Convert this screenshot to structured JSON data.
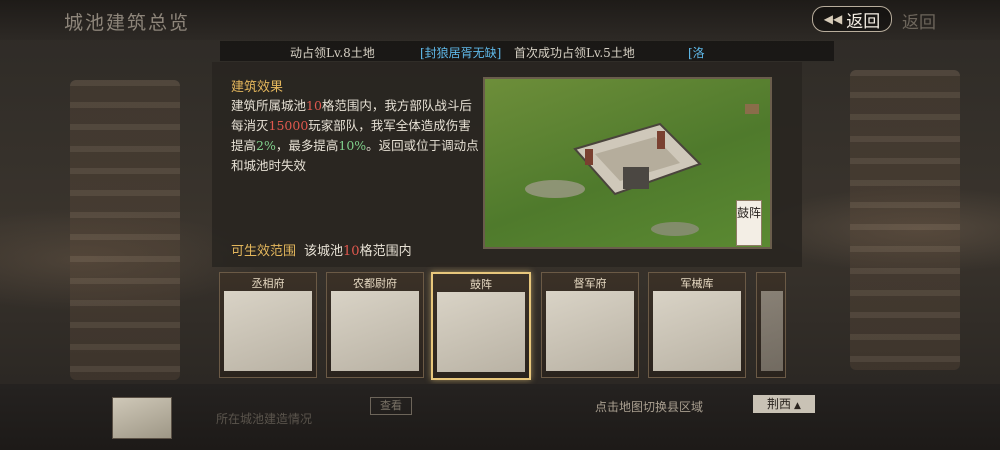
{
  "header": {
    "title": "城池建筑总览",
    "back_label": "返回",
    "back_ghost": "返回"
  },
  "ticker": {
    "part1": "动占领Lv.8土地",
    "tag": "[封狼居胥无缺]",
    "part2": "首次成功占领Lv.5土地",
    "part3": "[洛"
  },
  "effect": {
    "title": "建筑效果",
    "line_a": "建筑所属城池",
    "num_range": "10",
    "line_b": "格范围内，我方部队战斗后每消灭",
    "num_kill": "15000",
    "line_c": "玩家部队，我军全体造成伤害提高",
    "num_pct": "2%",
    "line_d": "，最多提高",
    "num_max": "10%",
    "line_e": "。返回或位于调动点和城池时失效"
  },
  "range": {
    "label": "可生效范围",
    "text_a": "该城池",
    "num": "10",
    "text_b": "格范围内"
  },
  "preview": {
    "name": "鼓阵"
  },
  "buildings": [
    {
      "label": "丞相府",
      "selected": false
    },
    {
      "label": "农都尉府",
      "selected": false
    },
    {
      "label": "鼓阵",
      "selected": true
    },
    {
      "label": "督军府",
      "selected": false
    },
    {
      "label": "军械库",
      "selected": false
    }
  ],
  "bottom": {
    "dim_text": "所在城池建造情况",
    "view_btn": "查看",
    "hint": "点击地图切换县区域",
    "region_btn": "荆西"
  },
  "colors": {
    "accent": "#e3b65c",
    "highlight": "#e0584e",
    "percent": "#7fcf8b",
    "tag": "#5fb8e8"
  }
}
